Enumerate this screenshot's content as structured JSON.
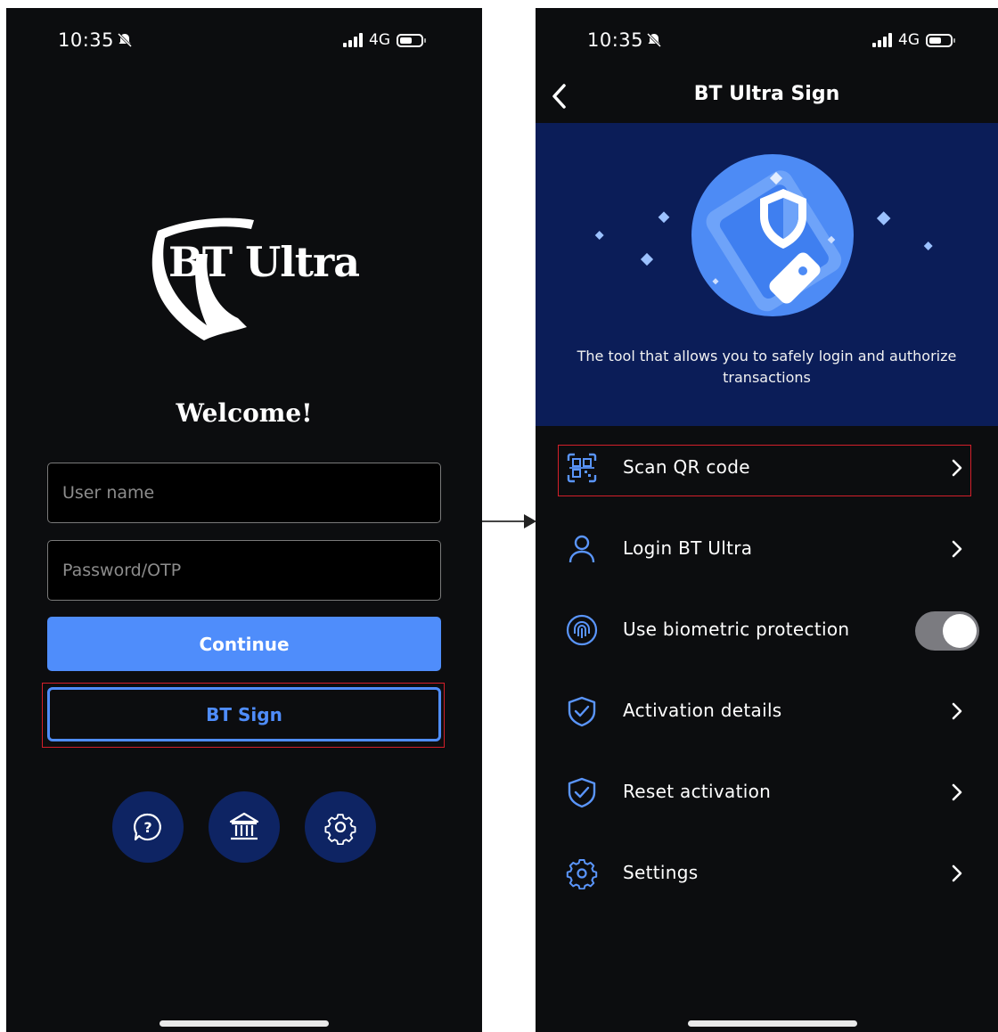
{
  "left_screen": {
    "status_bar": {
      "time": "10:35",
      "network": "4G"
    },
    "logo_text": "BT Ultra",
    "welcome": "Welcome!",
    "username_placeholder": "User name",
    "password_placeholder": "Password/OTP",
    "continue_label": "Continue",
    "bt_sign_label": "BT Sign",
    "round_buttons": [
      {
        "icon": "help-icon"
      },
      {
        "icon": "bank-icon"
      },
      {
        "icon": "gear-icon"
      }
    ]
  },
  "right_screen": {
    "status_bar": {
      "time": "10:35",
      "network": "4G"
    },
    "title": "BT Ultra Sign",
    "hero_text": "The tool that allows you to safely login and authorize transactions",
    "menu": [
      {
        "label": "Scan QR code",
        "icon": "qr-scan-icon",
        "control": "chevron"
      },
      {
        "label": "Login BT Ultra",
        "icon": "user-icon",
        "control": "chevron"
      },
      {
        "label": "Use biometric protection",
        "icon": "fingerprint-icon",
        "control": "toggle",
        "toggle_on": true
      },
      {
        "label": "Activation details",
        "icon": "shield-check-icon",
        "control": "chevron"
      },
      {
        "label": "Reset activation",
        "icon": "shield-check-icon",
        "control": "chevron"
      },
      {
        "label": "Settings",
        "icon": "gear-icon",
        "control": "chevron"
      }
    ]
  },
  "colors": {
    "background": "#0c0d0f",
    "accent": "#4f8dfb",
    "hero_bg": "#0b1d58",
    "round_button_bg": "#0e2463",
    "highlight": "#d31f2a"
  }
}
